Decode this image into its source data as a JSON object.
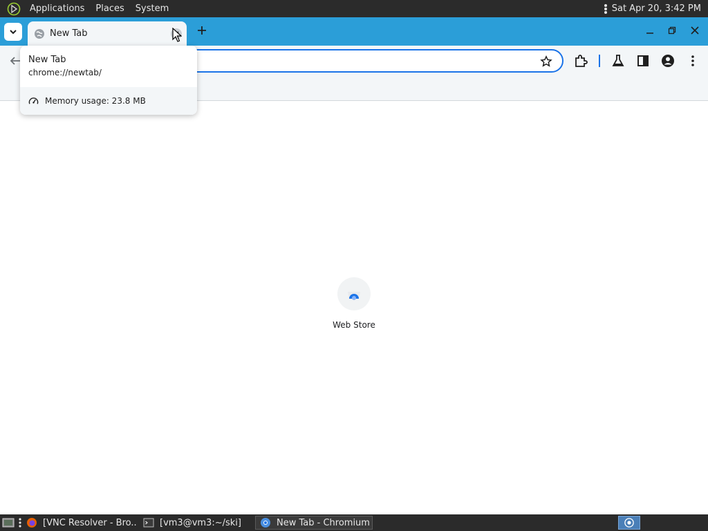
{
  "top_panel": {
    "menus": [
      "Applications",
      "Places",
      "System"
    ],
    "clock": "Sat Apr 20,  3:42 PM"
  },
  "browser": {
    "tab": {
      "title": "New Tab"
    },
    "hovercard": {
      "title": "New Tab",
      "url": "chrome://newtab/",
      "memory": "Memory usage: 23.8 MB"
    },
    "new_tab_page": {
      "shortcuts": [
        {
          "label": "Web Store"
        }
      ]
    },
    "colors": {
      "accent": "#1a73e8",
      "tabstrip": "#2b9ed8"
    }
  },
  "taskbar": {
    "items": [
      {
        "label": "[VNC Resolver - Bro..."
      },
      {
        "label": "[vm3@vm3:~/ski]"
      },
      {
        "label": "New Tab - Chromium"
      }
    ]
  }
}
